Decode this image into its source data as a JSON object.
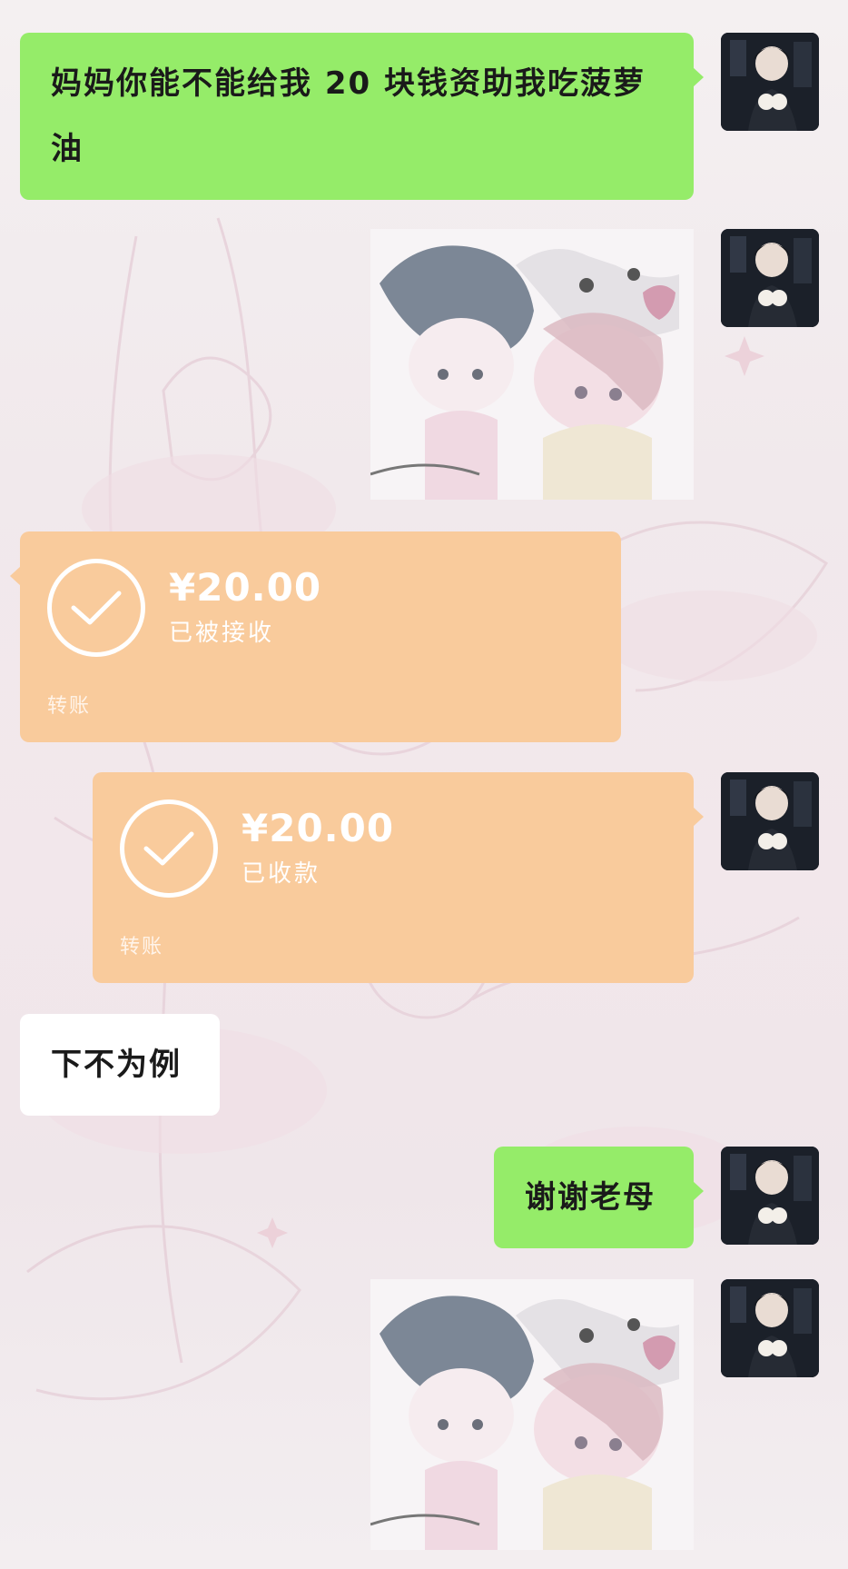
{
  "messages": {
    "m1": {
      "text": "妈妈你能不能给我 20 块钱资助我吃菠萝油"
    },
    "transfer_received": {
      "amount": "¥20.00",
      "status": "已被接收",
      "label": "转账"
    },
    "transfer_sent": {
      "amount": "¥20.00",
      "status": "已收款",
      "label": "转账"
    },
    "m_reply": {
      "text": "下不为例"
    },
    "m_thanks": {
      "text": "谢谢老母"
    }
  },
  "colors": {
    "self_bubble": "#95ec69",
    "other_bubble": "#ffffff",
    "transfer_bubble": "#f9cb9c"
  },
  "icons": {
    "check": "check-circle-icon"
  }
}
